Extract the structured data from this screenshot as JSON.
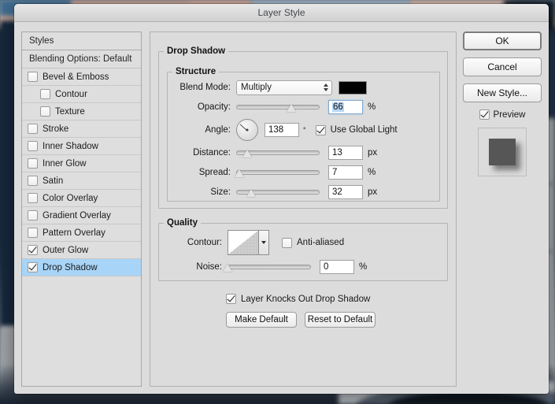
{
  "window": {
    "title": "Layer Style"
  },
  "styles_panel": {
    "header": "Styles",
    "blending_options": "Blending Options: Default",
    "items": [
      {
        "label": "Bevel & Emboss",
        "checked": false,
        "indent": false,
        "selected": false
      },
      {
        "label": "Contour",
        "checked": false,
        "indent": true,
        "selected": false
      },
      {
        "label": "Texture",
        "checked": false,
        "indent": true,
        "selected": false
      },
      {
        "label": "Stroke",
        "checked": false,
        "indent": false,
        "selected": false
      },
      {
        "label": "Inner Shadow",
        "checked": false,
        "indent": false,
        "selected": false
      },
      {
        "label": "Inner Glow",
        "checked": false,
        "indent": false,
        "selected": false
      },
      {
        "label": "Satin",
        "checked": false,
        "indent": false,
        "selected": false
      },
      {
        "label": "Color Overlay",
        "checked": false,
        "indent": false,
        "selected": false
      },
      {
        "label": "Gradient Overlay",
        "checked": false,
        "indent": false,
        "selected": false
      },
      {
        "label": "Pattern Overlay",
        "checked": false,
        "indent": false,
        "selected": false
      },
      {
        "label": "Outer Glow",
        "checked": true,
        "indent": false,
        "selected": false
      },
      {
        "label": "Drop Shadow",
        "checked": true,
        "indent": false,
        "selected": true
      }
    ]
  },
  "drop_shadow": {
    "group_title": "Drop Shadow",
    "structure": {
      "title": "Structure",
      "blend_mode": {
        "label": "Blend Mode:",
        "value": "Multiply",
        "color": "#000000"
      },
      "opacity": {
        "label": "Opacity:",
        "value": "66",
        "unit": "%",
        "slider_percent": 66,
        "focused": true
      },
      "angle": {
        "label": "Angle:",
        "value": "138",
        "unit": "°",
        "degrees": 138,
        "use_global_light_label": "Use Global Light",
        "use_global_light_checked": true
      },
      "distance": {
        "label": "Distance:",
        "value": "13",
        "unit": "px",
        "slider_percent": 13
      },
      "spread": {
        "label": "Spread:",
        "value": "7",
        "unit": "%",
        "slider_percent": 4
      },
      "size": {
        "label": "Size:",
        "value": "32",
        "unit": "px",
        "slider_percent": 18
      }
    },
    "quality": {
      "title": "Quality",
      "contour": {
        "label": "Contour:",
        "anti_aliased_label": "Anti-aliased",
        "anti_aliased_checked": false
      },
      "noise": {
        "label": "Noise:",
        "value": "0",
        "unit": "%",
        "slider_percent": 0
      }
    },
    "knockout": {
      "label": "Layer Knocks Out Drop Shadow",
      "checked": true
    },
    "make_default_label": "Make Default",
    "reset_default_label": "Reset to Default"
  },
  "actions": {
    "ok": "OK",
    "cancel": "Cancel",
    "new_style": "New Style...",
    "preview_label": "Preview",
    "preview_checked": true,
    "preview_swatch_color": "#565656"
  }
}
